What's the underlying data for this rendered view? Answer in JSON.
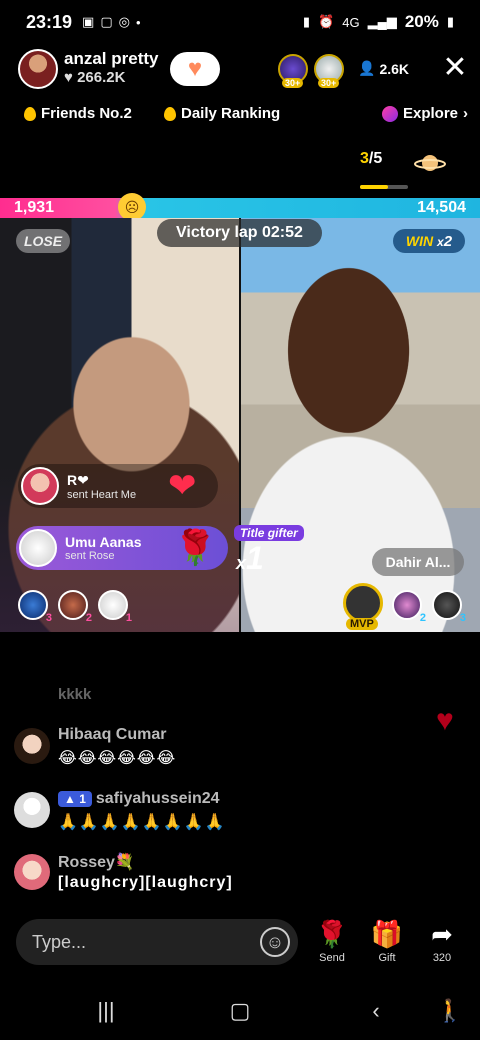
{
  "status_bar": {
    "time": "23:19",
    "network": "4G",
    "battery": "20%"
  },
  "host": {
    "name": "anzal pretty",
    "likes": "266.2K"
  },
  "viewers": {
    "count": "2.6K",
    "avatar_levels": [
      "30+",
      "30+"
    ]
  },
  "tabs": {
    "friends": "Friends No.2",
    "ranking": "Daily Ranking",
    "explore": "Explore"
  },
  "pager": {
    "current": "3",
    "total": "/5"
  },
  "battle": {
    "left_score": "1,931",
    "right_score": "14,504",
    "timer_label": "Victory lap  02:52",
    "lose_label": "LOSE",
    "win_label": "WIN",
    "win_multiplier_x": "x",
    "win_multiplier_n": "2"
  },
  "toasts": [
    {
      "name": "R❤",
      "action": "sent Heart Me"
    },
    {
      "name": "Umu Aanas",
      "action": "sent Rose"
    }
  ],
  "title_gifter": {
    "label": "Title gifter",
    "combo_x": "x",
    "combo_n": "1"
  },
  "right_host_label": "Dahir Al...",
  "left_ranks": [
    "3",
    "2",
    "1"
  ],
  "right_ranks": {
    "mvp": "MVP",
    "second": "2",
    "third": "3"
  },
  "chat": {
    "faded": "kkkk",
    "messages": [
      {
        "user": "Hibaaq Cumar",
        "text": "😂😂😂😂😂😂"
      },
      {
        "user": "safiyahussein24",
        "level": "1",
        "text": "🙏🙏🙏🙏🙏🙏🙏🙏"
      },
      {
        "user": "Rossey💐",
        "text": "[laughcry][laughcry]"
      }
    ]
  },
  "input": {
    "placeholder": "Type..."
  },
  "actions": {
    "send": "Send",
    "gift": "Gift",
    "share": "320"
  },
  "colors": {
    "lose_side": "#ff2d8f",
    "win_side": "#1fb5e0",
    "accent_yellow": "#ffd400"
  }
}
